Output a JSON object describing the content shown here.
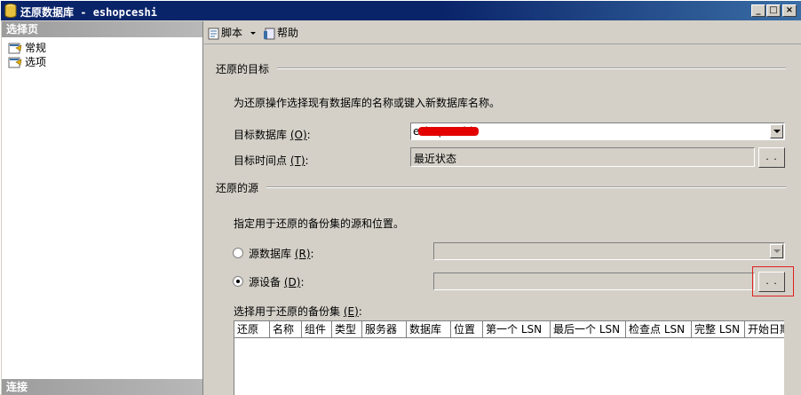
{
  "window": {
    "title_prefix": "还原数据库",
    "title_sep": " - ",
    "title_db": "eshopceshi",
    "minimize": "_",
    "maximize": "□",
    "close": "×"
  },
  "left_pane": {
    "header": "选择页",
    "items": [
      "常规",
      "选项"
    ],
    "footer": "连接"
  },
  "toolbar": {
    "script": "脚本",
    "help": "帮助"
  },
  "restore_target": {
    "heading": "还原的目标",
    "description": "为还原操作选择现有数据库的名称或键入新数据库名称。",
    "target_db_label": "目标数据库",
    "target_db_key": "(O)",
    "target_db_value": "eshopceshi",
    "target_time_label": "目标时间点",
    "target_time_key": "(T)",
    "target_time_value": "最近状态",
    "ellipsis": ". ."
  },
  "restore_source": {
    "heading": "还原的源",
    "description": "指定用于还原的备份集的源和位置。",
    "source_db_label": "源数据库",
    "source_db_key": "(R)",
    "source_device_label": "源设备",
    "source_device_key": "(D)",
    "ellipsis": ". .",
    "selected": "source_device"
  },
  "backup_sets": {
    "label": "选择用于还原的备份集",
    "key": "(E)",
    "columns": [
      "还原",
      "名称",
      "组件",
      "类型",
      "服务器",
      "数据库",
      "位置",
      "第一个 LSN",
      "最后一个 LSN",
      "检查点 LSN",
      "完整 LSN",
      "开始日期"
    ]
  },
  "colors": {
    "title_gradient_start": "#0a246a",
    "highlight_box": "#e02020",
    "redaction": "#e30000"
  }
}
